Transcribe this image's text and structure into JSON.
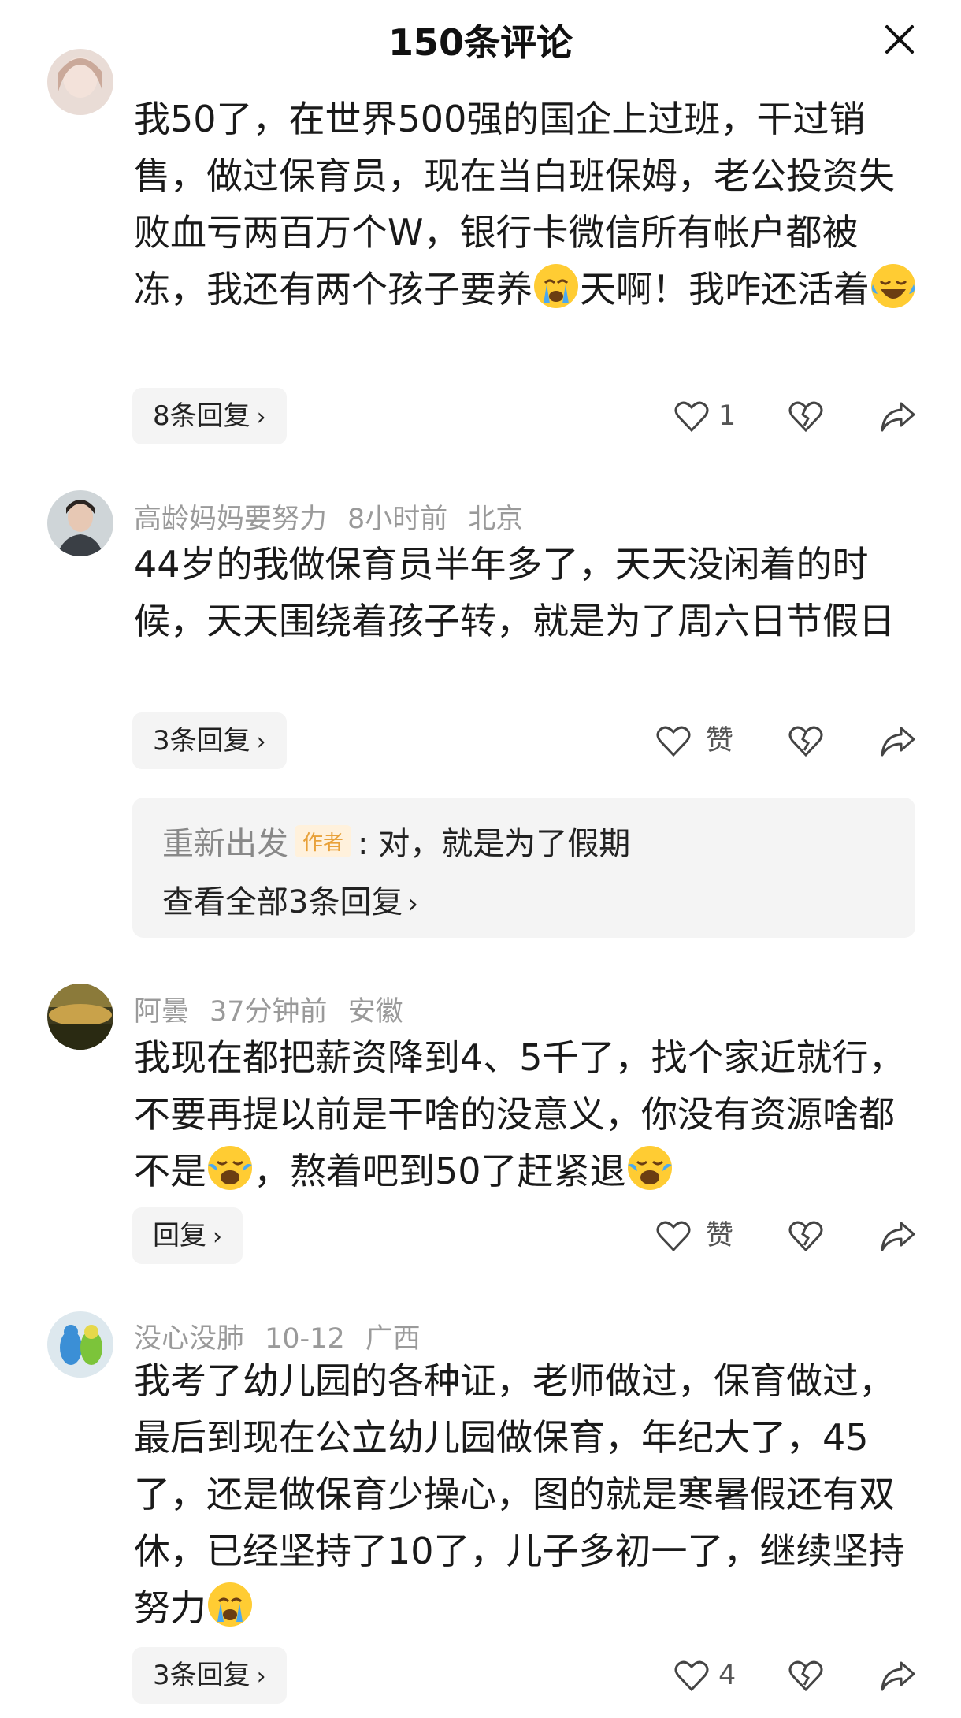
{
  "header": {
    "title": "150条评论"
  },
  "comments": [
    {
      "body_parts": [
        "我50了，在世界500强的国企上过班，干过销售，做过保育员，现在当白班保姆，老公投资失败血亏两百万个W，银行卡微信所有帐户都被冻，我还有两个孩子要养",
        "天啊！我咋还活着",
        ""
      ],
      "emojis": [
        "crying-face",
        "tears-of-joy"
      ],
      "reply_label": "8条回复",
      "like_label": "1"
    },
    {
      "user": "高龄妈妈要努力",
      "time": "8小时前",
      "location": "北京",
      "body": "44岁的我做保育员半年多了，天天没闲着的时候，天天围绕着孩子转，就是为了周六日节假日",
      "reply_label": "3条回复",
      "like_label": "赞",
      "author_reply": {
        "name": "重新出发",
        "tag": "作者",
        "text": ": 对，就是为了假期",
        "view_all": "查看全部3条回复"
      }
    },
    {
      "user": "阿曇",
      "time": "37分钟前",
      "location": "安徽",
      "body_parts": [
        "我现在都把薪资降到4、5千了，找个家近就行，不要再提以前是干啥的没意义，你没有资源啥都不是",
        "，熬着吧到50了赶紧退",
        ""
      ],
      "emojis": [
        "laughing-crying",
        "laughing-crying"
      ],
      "reply_label": "回复",
      "like_label": "赞"
    },
    {
      "user": "没心没肺",
      "time": "10-12",
      "location": "广西",
      "body_parts": [
        "我考了幼儿园的各种证，老师做过，保育做过，最后到现在公立幼儿园做保育，年纪大了，45了，还是做保育少操心，图的就是寒暑假还有双休，已经坚持了10了，儿子多初一了，继续坚持努力",
        ""
      ],
      "emojis": [
        "crying-face"
      ],
      "reply_label": "3条回复",
      "like_label": "4"
    }
  ]
}
